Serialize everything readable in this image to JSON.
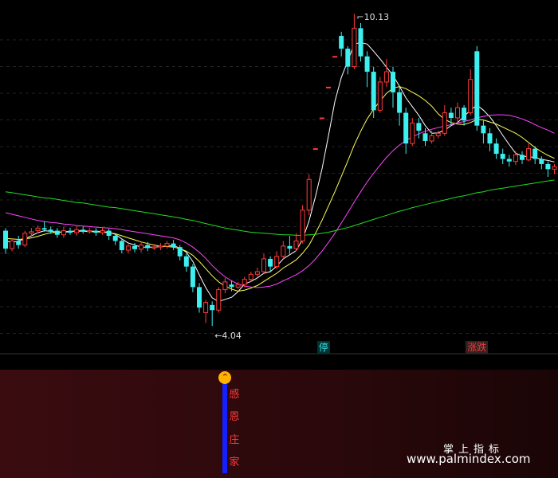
{
  "chart_data": {
    "type": "candlestick",
    "title": "",
    "xlabel": "",
    "ylabel": "",
    "ylim": [
      3.5,
      10.4
    ],
    "grid": true,
    "candles": [
      [
        5.9,
        5.55,
        5.95,
        5.45
      ],
      [
        5.55,
        5.7,
        5.75,
        5.5
      ],
      [
        5.7,
        5.62,
        5.8,
        5.55
      ],
      [
        5.62,
        5.85,
        5.9,
        5.58
      ],
      [
        5.85,
        5.88,
        5.95,
        5.78
      ],
      [
        5.9,
        5.95,
        6.0,
        5.85
      ],
      [
        5.95,
        5.92,
        6.08,
        5.88
      ],
      [
        5.92,
        5.88,
        5.98,
        5.84
      ],
      [
        5.9,
        5.82,
        5.95,
        5.76
      ],
      [
        5.82,
        5.9,
        5.98,
        5.76
      ],
      [
        5.9,
        5.86,
        5.96,
        5.82
      ],
      [
        5.86,
        5.92,
        6.0,
        5.8
      ],
      [
        5.92,
        5.88,
        5.98,
        5.84
      ],
      [
        5.88,
        5.9,
        5.96,
        5.84
      ],
      [
        5.9,
        5.86,
        5.95,
        5.8
      ],
      [
        5.86,
        5.9,
        5.96,
        5.82
      ],
      [
        5.9,
        5.8,
        5.94,
        5.72
      ],
      [
        5.8,
        5.7,
        5.84,
        5.62
      ],
      [
        5.7,
        5.52,
        5.75,
        5.46
      ],
      [
        5.52,
        5.6,
        5.66,
        5.46
      ],
      [
        5.6,
        5.54,
        5.66,
        5.48
      ],
      [
        5.54,
        5.62,
        5.68,
        5.48
      ],
      [
        5.62,
        5.56,
        5.68,
        5.5
      ],
      [
        5.56,
        5.58,
        5.64,
        5.52
      ],
      [
        5.58,
        5.6,
        5.66,
        5.52
      ],
      [
        5.6,
        5.65,
        5.7,
        5.55
      ],
      [
        5.65,
        5.58,
        5.72,
        5.52
      ],
      [
        5.58,
        5.4,
        5.62,
        5.32
      ],
      [
        5.4,
        5.2,
        5.45,
        5.1
      ],
      [
        5.2,
        4.8,
        5.25,
        4.7
      ],
      [
        4.8,
        4.4,
        4.88,
        4.3
      ],
      [
        4.3,
        4.5,
        4.55,
        4.1
      ],
      [
        4.45,
        4.35,
        4.52,
        4.04
      ],
      [
        4.35,
        4.75,
        4.8,
        4.3
      ],
      [
        4.75,
        4.9,
        4.98,
        4.68
      ],
      [
        4.85,
        4.8,
        4.92,
        4.72
      ],
      [
        4.8,
        4.85,
        4.9,
        4.76
      ],
      [
        4.85,
        4.95,
        5.0,
        4.8
      ],
      [
        4.95,
        5.05,
        5.1,
        4.9
      ],
      [
        5.05,
        5.1,
        5.18,
        5.0
      ],
      [
        5.1,
        5.35,
        5.45,
        5.05
      ],
      [
        5.35,
        5.2,
        5.4,
        5.1
      ],
      [
        5.2,
        5.4,
        5.5,
        5.15
      ],
      [
        5.4,
        5.6,
        5.7,
        5.35
      ],
      [
        5.6,
        5.55,
        5.8,
        5.45
      ],
      [
        5.55,
        5.7,
        5.85,
        5.5
      ],
      [
        5.7,
        6.3,
        6.4,
        5.65
      ],
      [
        6.3,
        6.9,
        7.0,
        6.2
      ],
      [
        7.5,
        7.5,
        7.5,
        7.5
      ],
      [
        8.1,
        8.1,
        8.1,
        8.1
      ],
      [
        8.7,
        8.7,
        8.7,
        8.7
      ],
      [
        9.3,
        9.3,
        9.3,
        9.3
      ],
      [
        9.7,
        9.45,
        9.78,
        9.3
      ],
      [
        9.45,
        9.1,
        9.5,
        8.95
      ],
      [
        9.1,
        9.85,
        10.13,
        9.05
      ],
      [
        9.85,
        9.3,
        9.95,
        9.2
      ],
      [
        9.3,
        9.0,
        9.4,
        8.7
      ],
      [
        9.0,
        8.25,
        9.1,
        8.1
      ],
      [
        8.25,
        8.8,
        8.9,
        8.2
      ],
      [
        8.8,
        9.0,
        9.25,
        8.7
      ],
      [
        9.0,
        8.6,
        9.1,
        8.3
      ],
      [
        8.6,
        8.2,
        8.7,
        7.95
      ],
      [
        8.2,
        7.6,
        8.3,
        7.4
      ],
      [
        7.6,
        8.0,
        8.1,
        7.55
      ],
      [
        8.0,
        7.85,
        8.1,
        7.7
      ],
      [
        7.8,
        7.65,
        7.9,
        7.55
      ],
      [
        7.65,
        7.75,
        7.85,
        7.6
      ],
      [
        7.75,
        7.8,
        7.85,
        7.7
      ],
      [
        7.8,
        8.2,
        8.35,
        7.75
      ],
      [
        8.2,
        8.1,
        8.3,
        7.95
      ],
      [
        8.1,
        8.3,
        8.4,
        8.0
      ],
      [
        8.3,
        8.05,
        8.35,
        7.95
      ],
      [
        8.2,
        8.85,
        9.05,
        8.15
      ],
      [
        9.4,
        7.95,
        9.5,
        7.85
      ],
      [
        7.95,
        7.8,
        8.05,
        7.6
      ],
      [
        7.8,
        7.6,
        7.9,
        7.45
      ],
      [
        7.6,
        7.4,
        7.7,
        7.3
      ],
      [
        7.4,
        7.3,
        7.5,
        7.2
      ],
      [
        7.3,
        7.25,
        7.38,
        7.15
      ],
      [
        7.25,
        7.38,
        7.45,
        7.18
      ],
      [
        7.38,
        7.28,
        7.45,
        7.2
      ],
      [
        7.28,
        7.5,
        7.6,
        7.25
      ],
      [
        7.5,
        7.3,
        7.55,
        7.2
      ],
      [
        7.3,
        7.2,
        7.35,
        7.1
      ],
      [
        7.2,
        7.1,
        7.25,
        6.95
      ],
      [
        7.1,
        7.15,
        7.2,
        7.0
      ],
      [
        7.15,
        7.25,
        7.3,
        7.08
      ]
    ],
    "series": [
      {
        "color": "#ffffff",
        "values": [
          5.7,
          5.67,
          5.7,
          5.74,
          5.8,
          5.86,
          5.9,
          5.89,
          5.87,
          5.87,
          5.88,
          5.9,
          5.9,
          5.89,
          5.89,
          5.88,
          5.87,
          5.83,
          5.74,
          5.66,
          5.62,
          5.58,
          5.58,
          5.58,
          5.59,
          5.6,
          5.61,
          5.56,
          5.48,
          5.3,
          5.04,
          4.79,
          4.59,
          4.52,
          4.56,
          4.6,
          4.71,
          4.86,
          4.91,
          4.98,
          5.07,
          5.1,
          5.21,
          5.35,
          5.43,
          5.51,
          5.73,
          6.09,
          6.57,
          7.1,
          7.75,
          8.42,
          8.89,
          9.21,
          9.54,
          9.57,
          9.54,
          9.4,
          9.25,
          9.09,
          8.93,
          8.72,
          8.49,
          8.32,
          8.15,
          7.95,
          7.8,
          7.81,
          7.86,
          7.95,
          8.01,
          8.13,
          8.25,
          8.35,
          8.25,
          8.12,
          7.95,
          7.76,
          7.58,
          7.41,
          7.36,
          7.34,
          7.33,
          7.29,
          7.27,
          7.24
        ]
      },
      {
        "color": "#ffff55",
        "values": [
          5.75,
          5.74,
          5.73,
          5.74,
          5.76,
          5.79,
          5.83,
          5.86,
          5.87,
          5.88,
          5.89,
          5.89,
          5.89,
          5.88,
          5.88,
          5.87,
          5.86,
          5.84,
          5.8,
          5.76,
          5.72,
          5.68,
          5.65,
          5.62,
          5.6,
          5.59,
          5.58,
          5.55,
          5.5,
          5.42,
          5.3,
          5.16,
          5.02,
          4.9,
          4.82,
          4.76,
          4.72,
          4.74,
          4.78,
          4.83,
          4.91,
          4.99,
          5.07,
          5.17,
          5.25,
          5.33,
          5.46,
          5.62,
          5.85,
          6.1,
          6.38,
          6.66,
          6.96,
          7.26,
          7.57,
          7.84,
          8.08,
          8.27,
          8.43,
          8.58,
          8.68,
          8.71,
          8.67,
          8.6,
          8.53,
          8.44,
          8.33,
          8.18,
          8.07,
          8.01,
          7.98,
          7.97,
          8.01,
          8.07,
          8.06,
          8.02,
          7.98,
          7.92,
          7.86,
          7.8,
          7.72,
          7.62,
          7.52,
          7.44,
          7.37,
          7.31
        ]
      },
      {
        "color": "#ff44ff",
        "values": [
          6.25,
          6.22,
          6.19,
          6.16,
          6.13,
          6.1,
          6.08,
          6.06,
          6.05,
          6.03,
          6.02,
          6.0,
          5.99,
          5.98,
          5.97,
          5.96,
          5.95,
          5.94,
          5.92,
          5.9,
          5.88,
          5.86,
          5.84,
          5.82,
          5.8,
          5.78,
          5.76,
          5.72,
          5.66,
          5.58,
          5.48,
          5.36,
          5.22,
          5.1,
          5.0,
          4.92,
          4.86,
          4.82,
          4.8,
          4.79,
          4.8,
          4.82,
          4.86,
          4.92,
          4.98,
          5.04,
          5.12,
          5.22,
          5.35,
          5.5,
          5.67,
          5.85,
          6.05,
          6.25,
          6.46,
          6.66,
          6.85,
          7.02,
          7.18,
          7.33,
          7.46,
          7.57,
          7.66,
          7.73,
          7.79,
          7.84,
          7.88,
          7.91,
          7.94,
          7.97,
          8.0,
          8.03,
          8.06,
          8.1,
          8.13,
          8.15,
          8.16,
          8.16,
          8.15,
          8.12,
          8.08,
          8.03,
          7.97,
          7.91,
          7.86,
          7.8
        ]
      },
      {
        "color": "#22dd22",
        "values": [
          6.66,
          6.64,
          6.62,
          6.6,
          6.58,
          6.56,
          6.54,
          6.53,
          6.51,
          6.49,
          6.47,
          6.45,
          6.44,
          6.42,
          6.4,
          6.38,
          6.36,
          6.35,
          6.33,
          6.31,
          6.29,
          6.27,
          6.25,
          6.23,
          6.21,
          6.19,
          6.17,
          6.15,
          6.12,
          6.1,
          6.07,
          6.04,
          6.01,
          5.98,
          5.95,
          5.93,
          5.91,
          5.89,
          5.87,
          5.86,
          5.85,
          5.84,
          5.83,
          5.82,
          5.82,
          5.81,
          5.81,
          5.82,
          5.83,
          5.85,
          5.87,
          5.9,
          5.93,
          5.96,
          6.0,
          6.04,
          6.08,
          6.12,
          6.16,
          6.2,
          6.24,
          6.28,
          6.31,
          6.35,
          6.38,
          6.41,
          6.44,
          6.47,
          6.5,
          6.53,
          6.56,
          6.58,
          6.61,
          6.64,
          6.66,
          6.69,
          6.71,
          6.73,
          6.75,
          6.77,
          6.79,
          6.81,
          6.83,
          6.85,
          6.87,
          6.89
        ]
      }
    ],
    "annotations": [
      {
        "text": "10.13",
        "index": 54,
        "value": 10.13
      },
      {
        "text": "4.04",
        "index": 32,
        "value": 4.04
      }
    ],
    "markers": [
      {
        "text": "停",
        "index": 49,
        "color": "#38e0e0",
        "bg": "#003333"
      },
      {
        "text": "涨跌",
        "index": 72,
        "color": "#ff3333",
        "bg": "#332222"
      }
    ],
    "signal_index": 34
  },
  "lower_panel": {
    "signal_chars": [
      "感",
      "恩",
      "庄",
      "家"
    ],
    "arrow_glyph": "⌃"
  },
  "watermark": {
    "line1": "掌上指标",
    "line2": "www.palmindex.com"
  }
}
